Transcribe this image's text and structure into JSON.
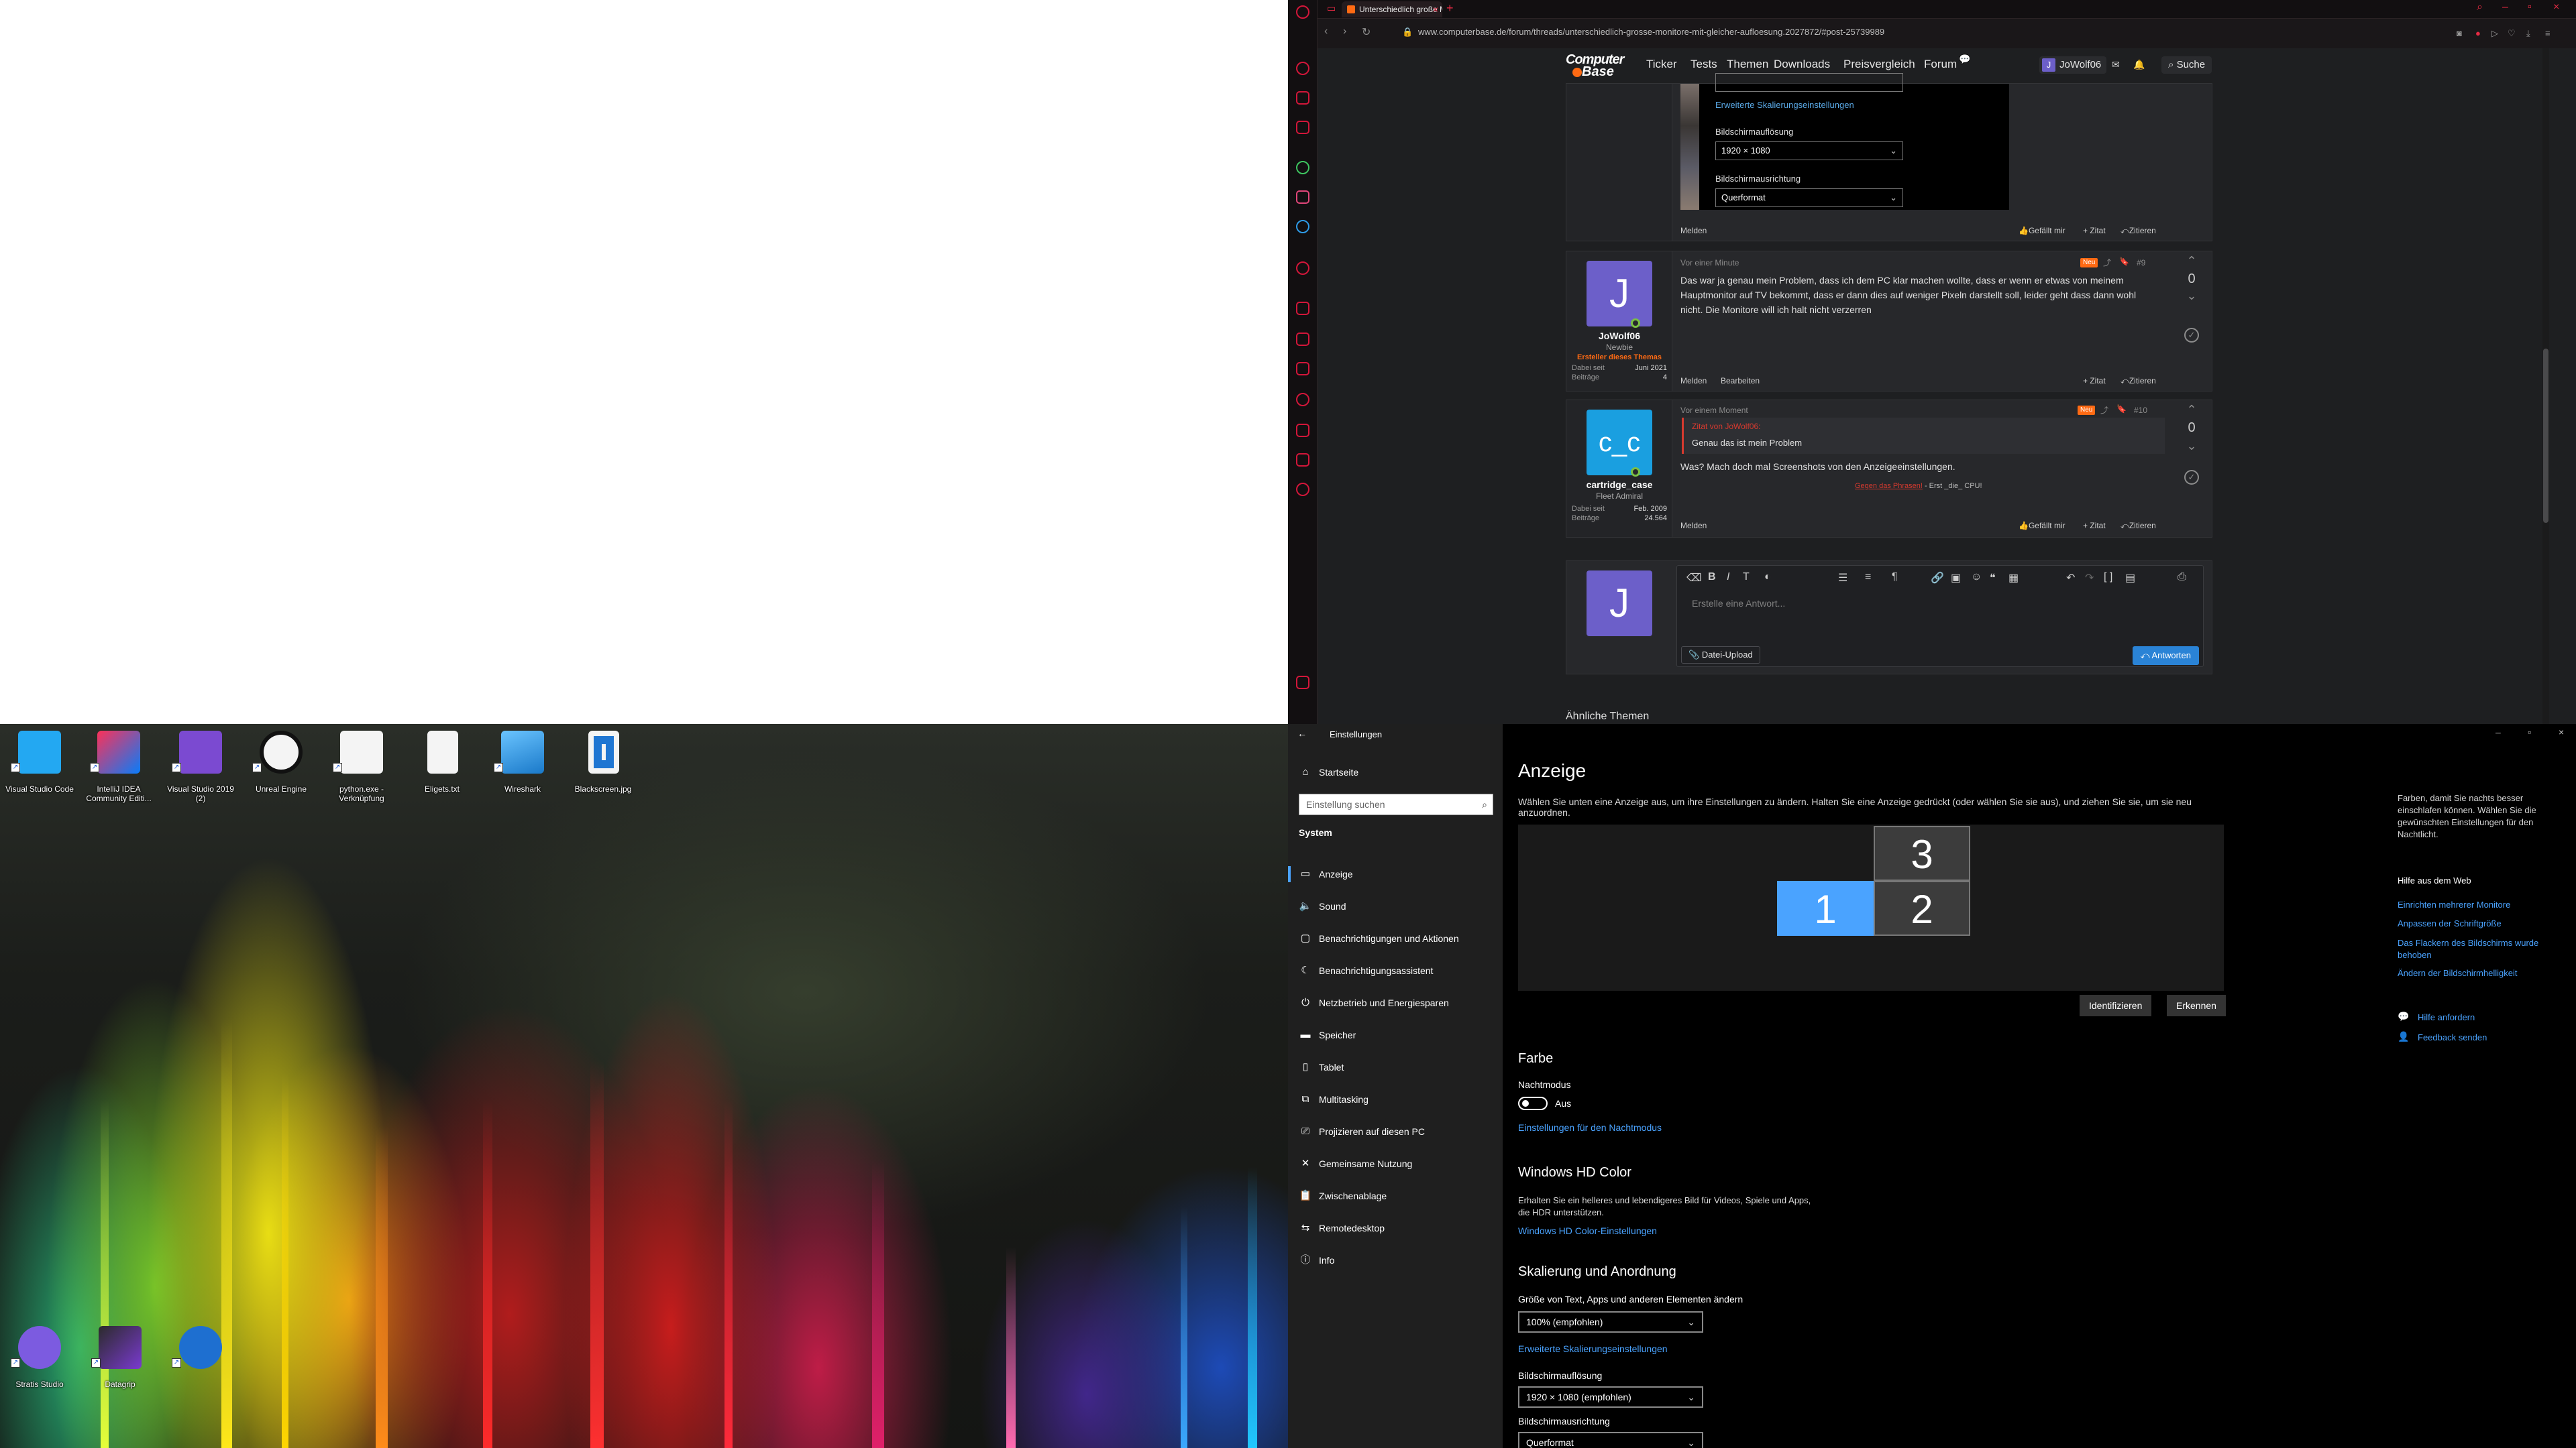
{
  "browser": {
    "tab_title": "Unterschiedlich große Mo...",
    "url": "www.computerbase.de/forum/threads/unterschiedlich-grosse-monitore-mit-gleicher-aufloesung.2027872/#post-25739989",
    "site": {
      "logo_line1": "Computer",
      "logo_line2": "Base",
      "nav": [
        "Ticker",
        "Tests",
        "Themen",
        "Downloads",
        "Preisvergleich",
        "Forum"
      ],
      "user": "JoWolf06",
      "user_initial": "J",
      "search": "Suche"
    },
    "embedded_settings": {
      "link": "Erweiterte Skalierungseinstellungen",
      "resolution_label": "Bildschirmauflösung",
      "resolution_value": "1920 × 1080",
      "orientation_label": "Bildschirmausrichtung",
      "orientation_value": "Querformat"
    },
    "post_prev_actions": {
      "report": "Melden",
      "like": "Gefällt mir",
      "quote": "+ Zitat",
      "reply": "Zitieren"
    },
    "post9": {
      "time": "Vor einer Minute",
      "badge": "Neu",
      "number": "#9",
      "user": "JoWolf06",
      "initial": "J",
      "rank": "Newbie",
      "thread_starter": "Ersteller dieses Themas",
      "joined_label": "Dabei seit",
      "joined": "Juni 2021",
      "posts_label": "Beiträge",
      "posts": "4",
      "text": "Das war ja genau mein Problem, dass ich dem PC klar machen wollte, dass er wenn er etwas von meinem Hauptmonitor auf TV bekommt, dass er dann dies auf weniger Pixeln darstellt soll, leider geht dass dann wohl nicht. Die Monitore will ich halt nicht verzerren",
      "report": "Melden",
      "edit": "Bearbeiten",
      "quote": "+ Zitat",
      "reply": "Zitieren",
      "votes": "0"
    },
    "post10": {
      "time": "Vor einem Moment",
      "badge": "Neu",
      "number": "#10",
      "user": "cartridge_case",
      "avatar_text": "c_c",
      "rank": "Fleet Admiral",
      "joined_label": "Dabei seit",
      "joined": "Feb. 2009",
      "posts_label": "Beiträge",
      "posts": "24.564",
      "quote_head": "Zitat von JoWolf06:",
      "quote_body": "Genau das ist mein Problem",
      "text": "Was? Mach doch mal Screenshots von den Anzeigeeinstellungen.",
      "sig_link": "Gegen das Phrasen!",
      "sig_rest": " - Erst _die_ CPU!",
      "report": "Melden",
      "like": "Gefällt mir",
      "quote": "+ Zitat",
      "reply": "Zitieren",
      "votes": "0"
    },
    "reply": {
      "initial": "J",
      "placeholder": "Erstelle eine Antwort...",
      "upload": "Datei-Upload",
      "send": "Antworten"
    },
    "similar": "Ähnliche Themen"
  },
  "desktop": {
    "icons_top": [
      {
        "label": "Visual Studio Code",
        "icon": "vscode-icon",
        "color": "#23a8f2"
      },
      {
        "label": "IntelliJ IDEA Community Editi...",
        "icon": "intellij-icon",
        "color": "#fc3158"
      },
      {
        "label": "Visual Studio 2019 (2)",
        "icon": "visual-studio-icon",
        "color": "#7b4ad1"
      },
      {
        "label": "Unreal Engine",
        "icon": "unreal-icon",
        "color": "#f4f4f4"
      },
      {
        "label": "python.exe - Verknüpfung",
        "icon": "python-icon",
        "color": "#f0c040"
      },
      {
        "label": "Eligets.txt",
        "icon": "text-file-icon",
        "color": "#f4f4f4"
      },
      {
        "label": "Wireshark",
        "icon": "wireshark-icon",
        "color": "#1a79c9"
      },
      {
        "label": "Blackscreen.jpg",
        "icon": "image-file-icon",
        "color": "#f4f4f4"
      }
    ],
    "icons_bottom": [
      {
        "label": "Stratis Studio",
        "icon": "stratis-icon",
        "color": "#7c5be0"
      },
      {
        "label": "Datagrip",
        "icon": "datagrip-icon",
        "color": "#2b2b2b"
      },
      {
        "label": "",
        "icon": "sound-icon",
        "color": "#1e6fd0"
      }
    ]
  },
  "settings": {
    "window_title": "Einstellungen",
    "home": "Startseite",
    "search_placeholder": "Einstellung suchen",
    "section": "System",
    "nav": [
      {
        "label": "Anzeige",
        "icon": "display-icon"
      },
      {
        "label": "Sound",
        "icon": "speaker-icon"
      },
      {
        "label": "Benachrichtigungen und Aktionen",
        "icon": "notification-icon"
      },
      {
        "label": "Benachrichtigungsassistent",
        "icon": "moon-icon"
      },
      {
        "label": "Netzbetrieb und Energiesparen",
        "icon": "power-icon"
      },
      {
        "label": "Speicher",
        "icon": "storage-icon"
      },
      {
        "label": "Tablet",
        "icon": "tablet-icon"
      },
      {
        "label": "Multitasking",
        "icon": "multitasking-icon"
      },
      {
        "label": "Projizieren auf diesen PC",
        "icon": "project-icon"
      },
      {
        "label": "Gemeinsame Nutzung",
        "icon": "share-icon"
      },
      {
        "label": "Zwischenablage",
        "icon": "clipboard-icon"
      },
      {
        "label": "Remotedesktop",
        "icon": "remote-icon"
      },
      {
        "label": "Info",
        "icon": "info-icon"
      }
    ],
    "title": "Anzeige",
    "description": "Wählen Sie unten eine Anzeige aus, um ihre Einstellungen zu ändern. Halten Sie eine Anzeige gedrückt (oder wählen Sie sie aus), und ziehen Sie sie, um sie neu anzuordnen.",
    "monitors": [
      "1",
      "2",
      "3"
    ],
    "identify": "Identifizieren",
    "detect": "Erkennen",
    "color_heading": "Farbe",
    "night_label": "Nachtmodus",
    "night_state": "Aus",
    "night_link": "Einstellungen für den Nachtmodus",
    "hd_heading": "Windows HD Color",
    "hd_text": "Erhalten Sie ein helleres und lebendigeres Bild für Videos, Spiele und Apps, die HDR unterstützen.",
    "hd_link": "Windows HD Color-Einstellungen",
    "scale_heading": "Skalierung und Anordnung",
    "scale_label": "Größe von Text, Apps und anderen Elementen ändern",
    "scale_value": "100% (empfohlen)",
    "scale_link": "Erweiterte Skalierungseinstellungen",
    "res_label": "Bildschirmauflösung",
    "res_value": "1920 × 1080 (empfohlen)",
    "orient_label": "Bildschirmausrichtung",
    "orient_value": "Querformat",
    "side_text": "Farben, damit Sie nachts besser einschlafen können. Wählen Sie die gewünschten Einstellungen für den Nachtlicht.",
    "help_heading": "Hilfe aus dem Web",
    "help_links": [
      "Einrichten mehrerer Monitore",
      "Anpassen der Schriftgröße",
      "Das Flackern des Bildschirms wurde behoben",
      "Ändern der Bildschirmhelligkeit"
    ],
    "get_help": "Hilfe anfordern",
    "feedback": "Feedback senden"
  }
}
